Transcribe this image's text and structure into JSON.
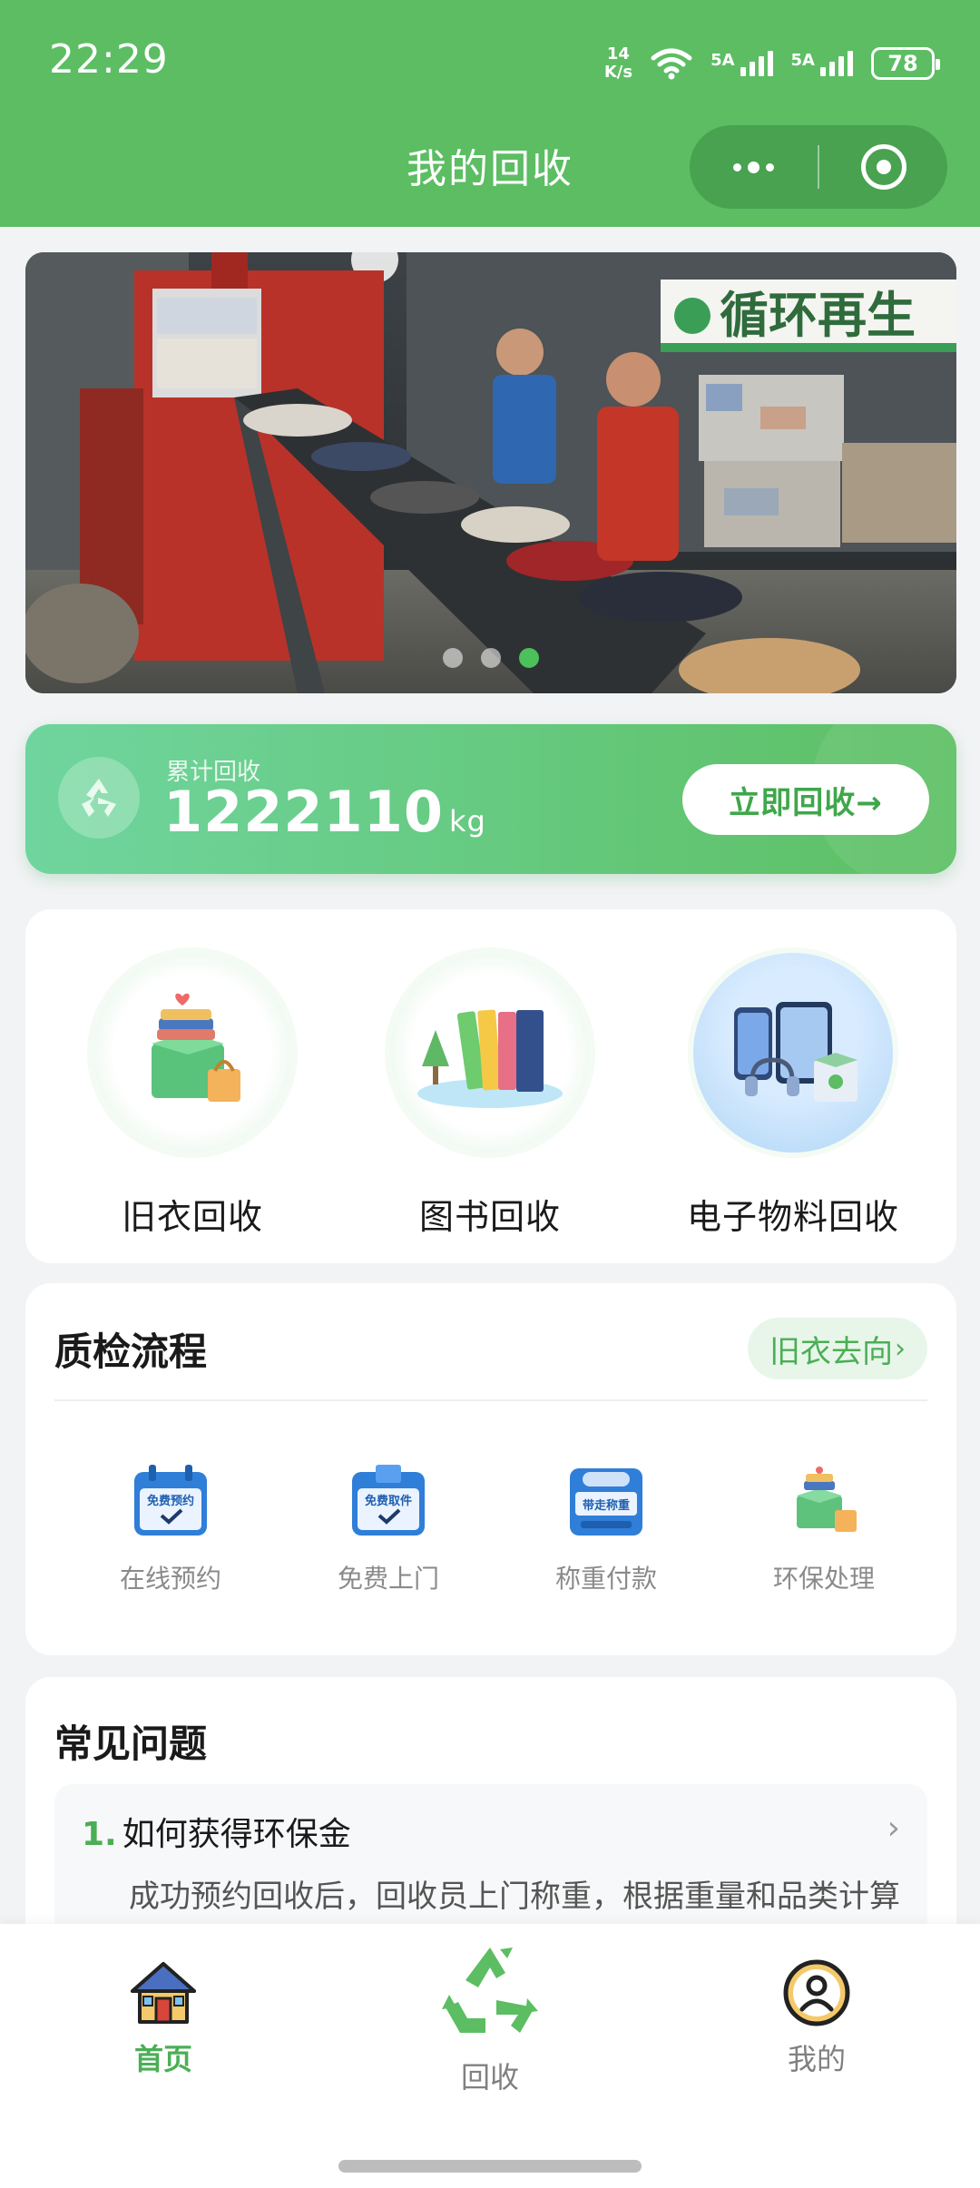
{
  "status_bar": {
    "time": "22:29",
    "net_speed_value": "14",
    "net_speed_unit": "K/s",
    "signal1_label": "5A",
    "signal2_label": "5A",
    "battery": "78"
  },
  "header": {
    "title": "我的回收"
  },
  "banner": {
    "sign_text": "循环再生",
    "slides": 3,
    "active_slide": 3
  },
  "stats": {
    "label": "累计回收",
    "value": "1222110",
    "unit": "kg",
    "button_label": "立即回收→"
  },
  "categories": [
    {
      "label": "旧衣回收",
      "icon": "clothes-box-icon"
    },
    {
      "label": "图书回收",
      "icon": "books-icon"
    },
    {
      "label": "电子物料回收",
      "icon": "electronics-icon"
    }
  ],
  "qc": {
    "title": "质检流程",
    "link_label": "旧衣去向",
    "steps": [
      {
        "label": "在线预约",
        "icon_text": "免费预约"
      },
      {
        "label": "免费上门",
        "icon_text": "免费取件"
      },
      {
        "label": "称重付款",
        "icon_text": "带走称重"
      },
      {
        "label": "环保处理",
        "icon_text": ""
      }
    ]
  },
  "faq": {
    "title": "常见问题",
    "items": [
      {
        "number": "1.",
        "question": "如何获得环保金",
        "answer": "成功预约回收后，回收员上门称重，根据重量和品类计算"
      }
    ]
  },
  "tabbar": {
    "items": [
      {
        "label": "首页",
        "active": true
      },
      {
        "label": "回收",
        "active": false
      },
      {
        "label": "我的",
        "active": false
      }
    ]
  },
  "colors": {
    "brand_green": "#5cbd63",
    "accent_green": "#4bae55"
  }
}
